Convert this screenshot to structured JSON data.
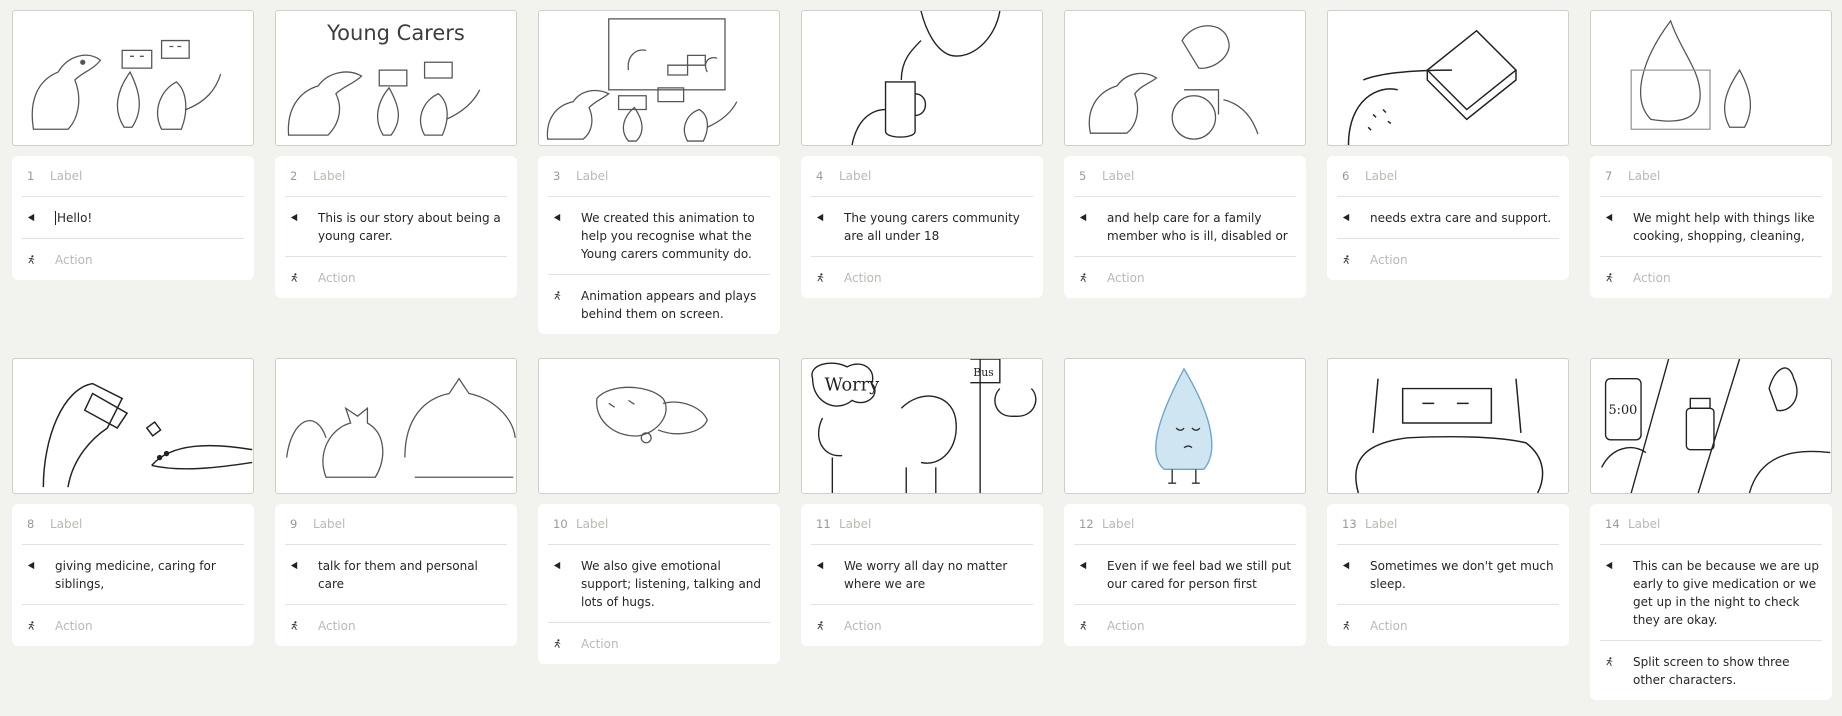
{
  "label_placeholder": "Label",
  "action_placeholder": "Action",
  "frame1_thumb_title": "Young Carers",
  "frames": [
    {
      "num": "1",
      "dialogue": "Hello!",
      "action": ""
    },
    {
      "num": "2",
      "dialogue": "This is our story about being a young carer.",
      "action": ""
    },
    {
      "num": "3",
      "dialogue": "We created this animation to help you recognise what the Young carers community do.",
      "action": "Animation appears and plays behind them on screen."
    },
    {
      "num": "4",
      "dialogue": "The young carers community are all under 18",
      "action": ""
    },
    {
      "num": "5",
      "dialogue": "and help care for a family member who is ill, disabled or",
      "action": ""
    },
    {
      "num": "6",
      "dialogue": "needs extra care and support.",
      "action": ""
    },
    {
      "num": "7",
      "dialogue": "We might help with things like cooking,  shopping, cleaning,",
      "action": ""
    },
    {
      "num": "8",
      "dialogue": "giving medicine, caring for siblings,",
      "action": ""
    },
    {
      "num": "9",
      "dialogue": "talk for them and personal care",
      "action": ""
    },
    {
      "num": "10",
      "dialogue": "We also give emotional support; listening, talking  and lots of hugs.",
      "action": ""
    },
    {
      "num": "11",
      "dialogue": "We worry all day no matter where we are",
      "action": ""
    },
    {
      "num": "12",
      "dialogue": "Even if we feel bad we still put our cared for person first",
      "action": ""
    },
    {
      "num": "13",
      "dialogue": "Sometimes we don't get much sleep.",
      "action": ""
    },
    {
      "num": "14",
      "dialogue": "This can be because we are up early to give medication or we get up in the night to check they are okay.",
      "action": "Split screen to show three other characters."
    }
  ],
  "sketch_text": {
    "worry": "Worry",
    "bus": "Bus",
    "clock": "5:00"
  }
}
